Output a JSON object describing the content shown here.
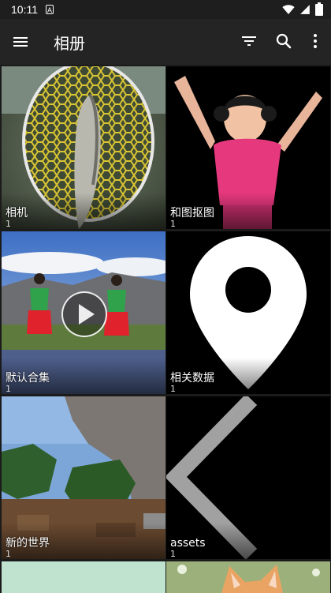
{
  "status": {
    "time": "10:11",
    "app_letter": "A"
  },
  "toolbar": {
    "title": "相册"
  },
  "albums": [
    {
      "name": "相机",
      "count": "1"
    },
    {
      "name": "和图抠图",
      "count": "1"
    },
    {
      "name": "默认合集",
      "count": "1"
    },
    {
      "name": "相关数据",
      "count": "1"
    },
    {
      "name": "新的世界",
      "count": "1"
    },
    {
      "name": "assets",
      "count": "1"
    }
  ],
  "icons": [
    "menu-icon",
    "filter-icon",
    "search-icon",
    "more-vert-icon",
    "play-icon",
    "wifi-icon",
    "signal-icon",
    "battery-icon"
  ]
}
